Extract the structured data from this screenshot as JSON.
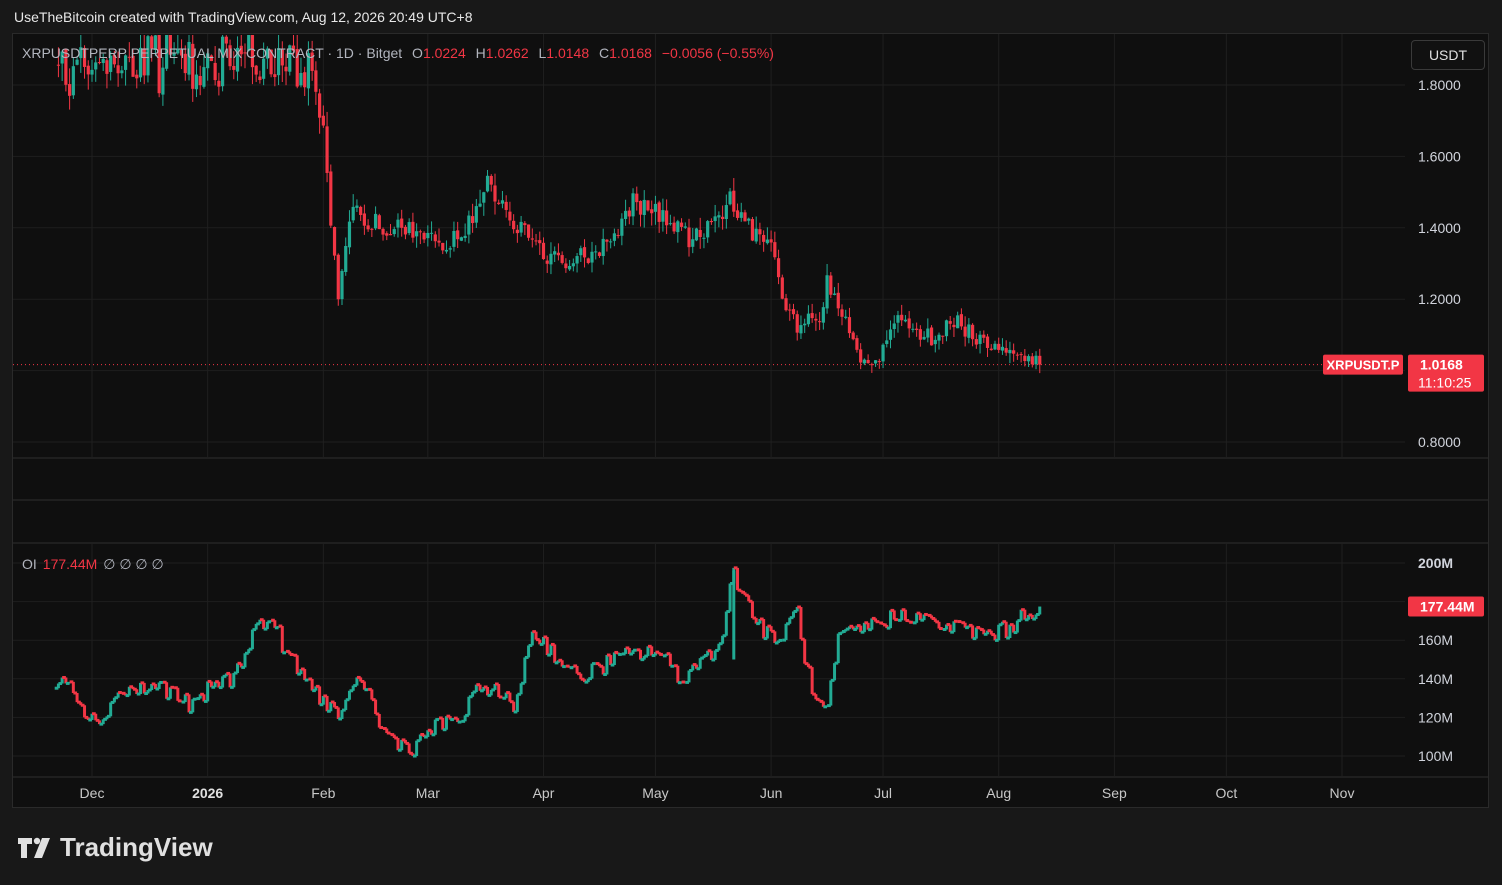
{
  "header": {
    "caption": "UseTheBitcoin created with TradingView.com, Aug 12, 2026 20:49 UTC+8"
  },
  "legend": {
    "symbol": "XRPUSDTPERP PERPETUAL MIX CONTRACT · 1D · Bitget",
    "o_label": "O",
    "o": "1.0224",
    "h_label": "H",
    "h": "1.0262",
    "l_label": "L",
    "l": "1.0148",
    "c_label": "C",
    "c": "1.0168",
    "change": "−0.0056 (−0.55%)"
  },
  "oi_legend": {
    "name": "OI",
    "value": "177.44M",
    "extras": "∅ ∅ ∅ ∅"
  },
  "currency_button": "USDT",
  "price_tag": {
    "symbol": "XRPUSDT.P",
    "price": "1.0168",
    "countdown": "11:10:25"
  },
  "oi_tag": "177.44M",
  "brand": "TradingView",
  "colors": {
    "up": "#22ab94",
    "down": "#f23645",
    "background": "#0f0f0f",
    "grid": "#1f1f1f"
  },
  "chart_data": [
    {
      "type": "candlestick",
      "title": "XRPUSDTPERP PERPETUAL MIX CONTRACT · 1D · Bitget",
      "y_ticks": [
        "1.8000",
        "1.6000",
        "1.4000",
        "1.2000",
        "0.8000"
      ],
      "ylim": [
        0.8,
        1.8
      ],
      "last": 1.0168,
      "x_ticks": [
        "Dec",
        "2026",
        "Feb",
        "Mar",
        "Apr",
        "May",
        "Jun",
        "Jul",
        "Aug",
        "Sep",
        "Oct",
        "Nov"
      ],
      "key_closes": [
        {
          "date": "2026-01-28",
          "value": 1.85
        },
        {
          "date": "2026-02-01",
          "value": 1.66
        },
        {
          "date": "2026-02-05",
          "value": 1.19
        },
        {
          "date": "2026-02-08",
          "value": 1.44
        },
        {
          "date": "2026-02-20",
          "value": 1.4
        },
        {
          "date": "2026-03-01",
          "value": 1.37
        },
        {
          "date": "2026-03-10",
          "value": 1.36
        },
        {
          "date": "2026-03-17",
          "value": 1.53
        },
        {
          "date": "2026-03-23",
          "value": 1.43
        },
        {
          "date": "2026-04-01",
          "value": 1.32
        },
        {
          "date": "2026-04-10",
          "value": 1.31
        },
        {
          "date": "2026-04-18",
          "value": 1.36
        },
        {
          "date": "2026-04-25",
          "value": 1.47
        },
        {
          "date": "2026-05-05",
          "value": 1.42
        },
        {
          "date": "2026-05-10",
          "value": 1.37
        },
        {
          "date": "2026-05-18",
          "value": 1.41
        },
        {
          "date": "2026-05-21",
          "value": 1.48
        },
        {
          "date": "2026-05-28",
          "value": 1.38
        },
        {
          "date": "2026-06-02",
          "value": 1.32
        },
        {
          "date": "2026-06-04",
          "value": 1.19
        },
        {
          "date": "2026-06-08",
          "value": 1.12
        },
        {
          "date": "2026-06-14",
          "value": 1.15
        },
        {
          "date": "2026-06-16",
          "value": 1.24
        },
        {
          "date": "2026-06-22",
          "value": 1.11
        },
        {
          "date": "2026-06-25",
          "value": 1.03
        },
        {
          "date": "2026-07-01",
          "value": 1.05
        },
        {
          "date": "2026-07-04",
          "value": 1.15
        },
        {
          "date": "2026-07-10",
          "value": 1.1
        },
        {
          "date": "2026-07-15",
          "value": 1.09
        },
        {
          "date": "2026-07-20",
          "value": 1.14
        },
        {
          "date": "2026-07-28",
          "value": 1.08
        },
        {
          "date": "2026-08-02",
          "value": 1.07
        },
        {
          "date": "2026-08-07",
          "value": 1.04
        },
        {
          "date": "2026-08-12",
          "value": 1.0168
        }
      ]
    },
    {
      "type": "bar",
      "title": "OI",
      "y_ticks": [
        "200M",
        "160M",
        "140M",
        "120M",
        "100M"
      ],
      "ylim": [
        100,
        200
      ],
      "unit": "M",
      "last": 177.44,
      "key_values": [
        {
          "date": "2025-11-21",
          "value": 138
        },
        {
          "date": "2025-11-23",
          "value": 145
        },
        {
          "date": "2025-11-28",
          "value": 128
        },
        {
          "date": "2025-12-02",
          "value": 116
        },
        {
          "date": "2025-12-08",
          "value": 133
        },
        {
          "date": "2025-12-20",
          "value": 136
        },
        {
          "date": "2025-12-28",
          "value": 125
        },
        {
          "date": "2026-01-03",
          "value": 138
        },
        {
          "date": "2026-01-08",
          "value": 140
        },
        {
          "date": "2026-01-13",
          "value": 165
        },
        {
          "date": "2026-01-18",
          "value": 171
        },
        {
          "date": "2026-01-23",
          "value": 150
        },
        {
          "date": "2026-01-29",
          "value": 135
        },
        {
          "date": "2026-02-06",
          "value": 120
        },
        {
          "date": "2026-02-11",
          "value": 142
        },
        {
          "date": "2026-02-17",
          "value": 112
        },
        {
          "date": "2026-02-25",
          "value": 103
        },
        {
          "date": "2026-03-01",
          "value": 113
        },
        {
          "date": "2026-03-10",
          "value": 120
        },
        {
          "date": "2026-03-16",
          "value": 138
        },
        {
          "date": "2026-03-24",
          "value": 125
        },
        {
          "date": "2026-03-29",
          "value": 165
        },
        {
          "date": "2026-04-03",
          "value": 155
        },
        {
          "date": "2026-04-10",
          "value": 140
        },
        {
          "date": "2026-04-20",
          "value": 150
        },
        {
          "date": "2026-05-01",
          "value": 155
        },
        {
          "date": "2026-05-08",
          "value": 140
        },
        {
          "date": "2026-05-18",
          "value": 158
        },
        {
          "date": "2026-05-22",
          "value": 195
        },
        {
          "date": "2026-05-28",
          "value": 170
        },
        {
          "date": "2026-06-02",
          "value": 158
        },
        {
          "date": "2026-06-08",
          "value": 175
        },
        {
          "date": "2026-06-12",
          "value": 130
        },
        {
          "date": "2026-06-16",
          "value": 122
        },
        {
          "date": "2026-06-19",
          "value": 160
        },
        {
          "date": "2026-06-24",
          "value": 165
        },
        {
          "date": "2026-07-01",
          "value": 170
        },
        {
          "date": "2026-07-08",
          "value": 174
        },
        {
          "date": "2026-07-15",
          "value": 168
        },
        {
          "date": "2026-07-22",
          "value": 166
        },
        {
          "date": "2026-07-28",
          "value": 163
        },
        {
          "date": "2026-08-03",
          "value": 165
        },
        {
          "date": "2026-08-08",
          "value": 174
        },
        {
          "date": "2026-08-12",
          "value": 177.44
        }
      ]
    }
  ]
}
